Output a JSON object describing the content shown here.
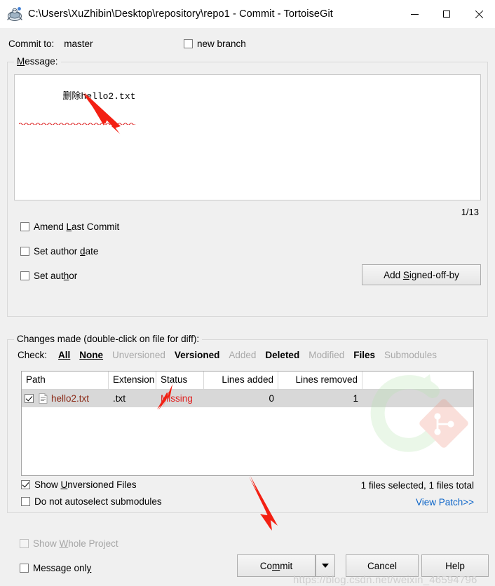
{
  "window": {
    "title": "C:\\Users\\XuZhibin\\Desktop\\repository\\repo1 - Commit - TortoiseGit",
    "icon": "tortoisegit-turtle-icon",
    "minimize_label": "—",
    "maximize_label": "□",
    "close_label": "✕"
  },
  "commit_to": {
    "label": "Commit to:",
    "branch": "master",
    "new_branch_label": "new branch",
    "new_branch_checked": false
  },
  "message": {
    "group_title": "Message:",
    "text": "删除hello2.txt",
    "spellcheck_underline": true,
    "counter": "1/13"
  },
  "options": [
    {
      "id": "amend-last-commit",
      "label": "Amend Last Commit",
      "checked": false,
      "disabled": false
    },
    {
      "id": "set-author-date",
      "label": "Set author date",
      "checked": false,
      "disabled": false
    },
    {
      "id": "set-author",
      "label": "Set author",
      "checked": false,
      "disabled": false
    }
  ],
  "signoff_button": "Add Signed-off-by",
  "changes": {
    "group_title": "Changes made (double-click on file for diff):",
    "check_label": "Check:",
    "filters": [
      {
        "label": "All",
        "state": "active-underline"
      },
      {
        "label": "None",
        "state": "active-underline"
      },
      {
        "label": "Unversioned",
        "state": "disabled"
      },
      {
        "label": "Versioned",
        "state": "active"
      },
      {
        "label": "Added",
        "state": "disabled"
      },
      {
        "label": "Deleted",
        "state": "active"
      },
      {
        "label": "Modified",
        "state": "disabled"
      },
      {
        "label": "Files",
        "state": "active"
      },
      {
        "label": "Submodules",
        "state": "disabled"
      }
    ],
    "columns": [
      "Path",
      "Extension",
      "Status",
      "Lines added",
      "Lines removed"
    ],
    "rows": [
      {
        "checked": true,
        "path": "hello2.txt",
        "extension": ".txt",
        "status": "Missing",
        "lines_added": "0",
        "lines_removed": "1"
      }
    ],
    "watermark_logo": "tortoisegit-logo",
    "files_count": "1 files selected, 1 files total",
    "view_patch": "View Patch>>"
  },
  "bottom_checks": [
    {
      "id": "show-unversioned-files",
      "label": "Show Unversioned Files",
      "checked": true,
      "disabled": false
    },
    {
      "id": "do-not-autoselect-submodules",
      "label": "Do not autoselect submodules",
      "checked": false,
      "disabled": false
    },
    {
      "id": "show-whole-project",
      "label": "Show Whole Project",
      "checked": false,
      "disabled": true
    },
    {
      "id": "message-only",
      "label": "Message only",
      "checked": false,
      "disabled": false
    }
  ],
  "buttons": {
    "commit": "Commit",
    "commit_dropdown": "chevron-down-icon",
    "cancel": "Cancel",
    "help": "Help"
  },
  "watermark": "https://blog.csdn.net/weixin_46594796",
  "colors": {
    "accent_link": "#0b64c8",
    "status_missing": "#e02020",
    "file_name": "#8b2a17",
    "annotation_arrow": "#f32013",
    "window_bg": "#f0f0f0"
  },
  "annotations": [
    {
      "name": "arrow-to-message",
      "points_to": "commit message text"
    },
    {
      "name": "arrow-to-status",
      "points_to": "Missing status cell"
    },
    {
      "name": "arrow-to-commit-button",
      "points_to": "Commit button"
    }
  ]
}
